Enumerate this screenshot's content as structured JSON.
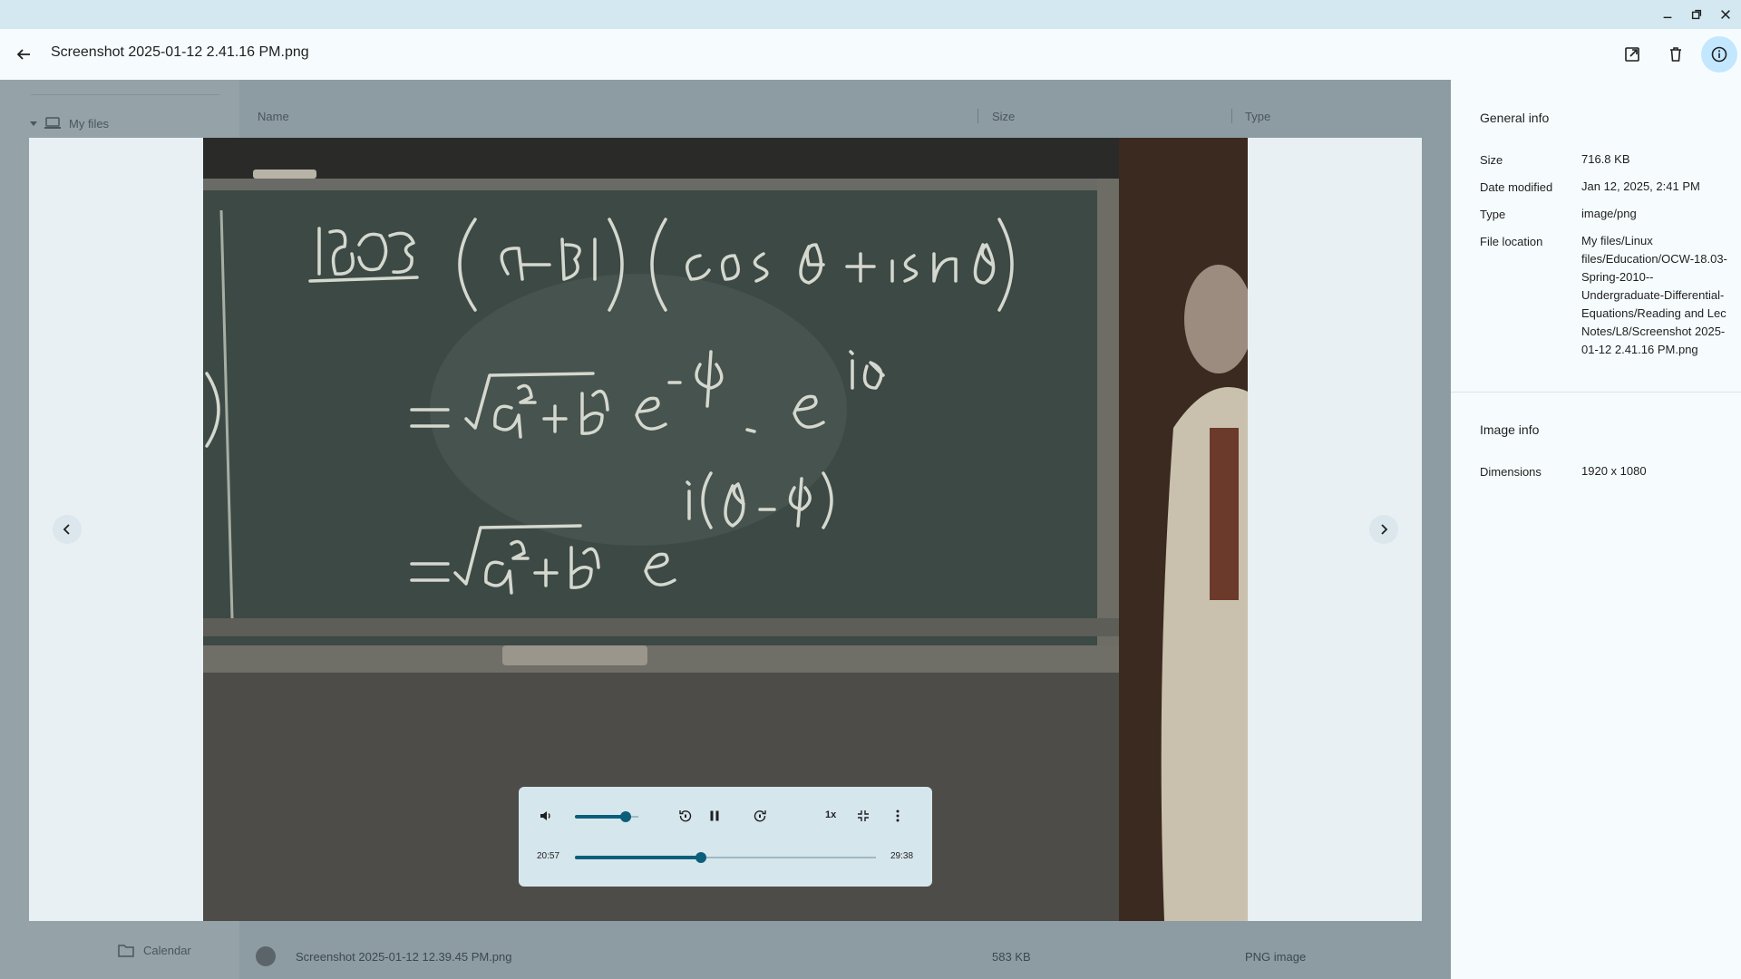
{
  "window": {
    "controls": [
      "minimize-icon",
      "restore-icon",
      "close-icon"
    ]
  },
  "header": {
    "title": "Screenshot 2025-01-12 2.41.16 PM.png",
    "actions": [
      "open-external-icon",
      "delete-icon",
      "info-icon"
    ]
  },
  "background_files": {
    "sidebar": {
      "my_files": "My files",
      "calendar": "Calendar"
    },
    "columns": {
      "name": "Name",
      "size": "Size",
      "type": "Type"
    },
    "rows": [
      {
        "name": "Screenshot 2025-01-12 12.39.45 PM.png",
        "size": "583 KB",
        "type": "PNG image"
      }
    ]
  },
  "player": {
    "volume_fraction": 0.8,
    "speed": "1x",
    "current_time": "20:57",
    "duration": "29:38",
    "progress_fraction": 0.42,
    "icons": [
      "volume-icon",
      "replay-10-icon",
      "pause-icon",
      "forward-10-icon",
      "exit-fullscreen-icon",
      "more-vert-icon"
    ]
  },
  "info": {
    "general_title": "General info",
    "general": [
      {
        "label": "Size",
        "value": "716.8 KB"
      },
      {
        "label": "Date modified",
        "value": "Jan 12, 2025, 2:41 PM"
      },
      {
        "label": "Type",
        "value": "image/png"
      },
      {
        "label": "File location",
        "value": "My files/Linux files/Education/OCW-18.03-Spring-2010--Undergraduate-Differential-Equations/Reading and Lec Notes/L8/Screenshot 2025-01-12 2.41.16 PM.png"
      }
    ],
    "image_title": "Image info",
    "image": [
      {
        "label": "Dimensions",
        "value": "1920 x 1080"
      }
    ]
  },
  "colors": {
    "accent": "#0b5f7a",
    "active_button": "#c2e7ff",
    "titlebar": "#d3e8f0"
  }
}
